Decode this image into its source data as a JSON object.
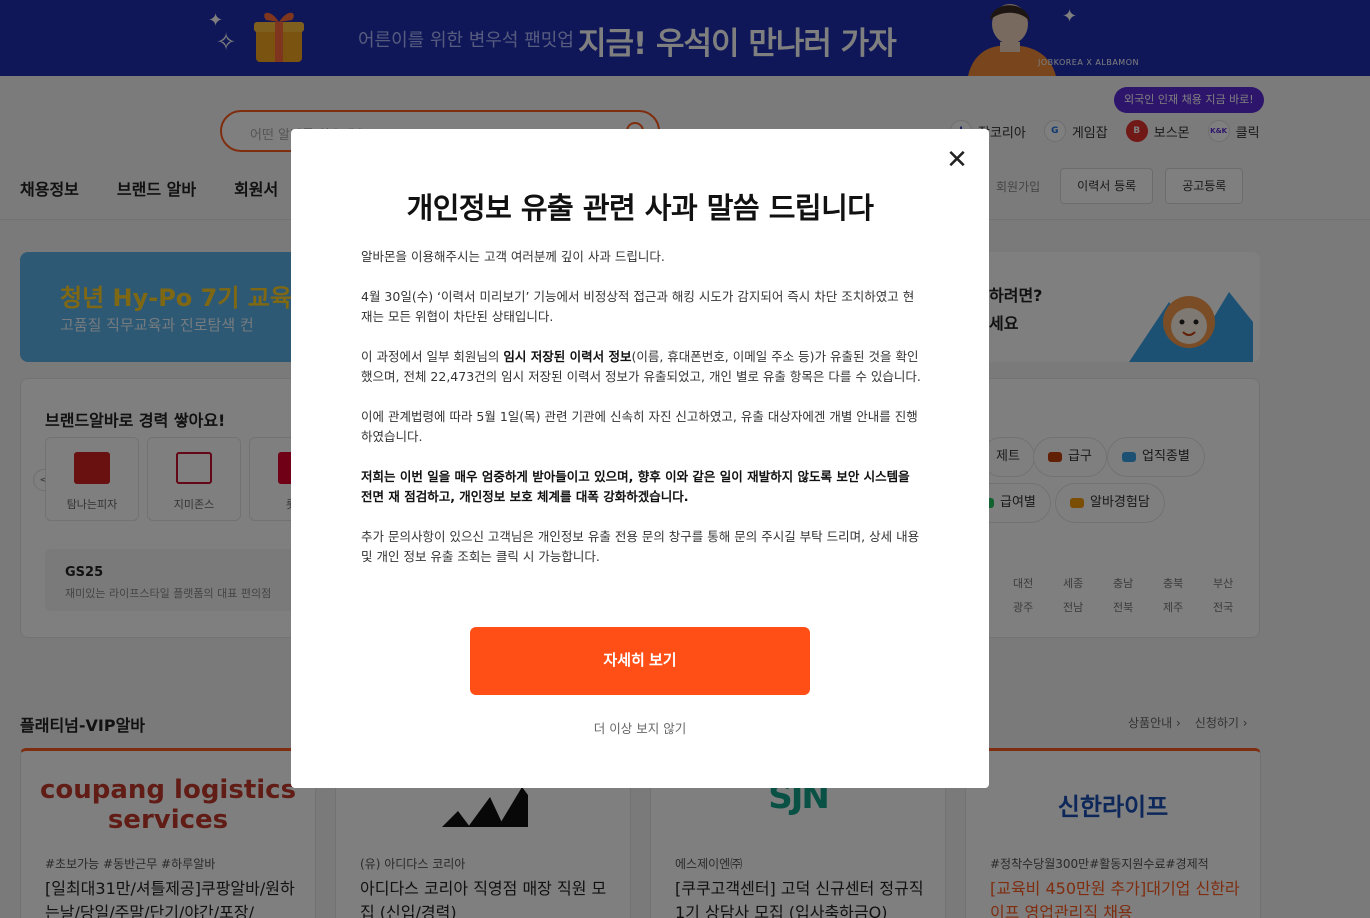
{
  "banner": {
    "sub_text": "어른이를 위한 변우석 팬밋업",
    "main_text": "지금! 우석이 만나러 가자",
    "brandmark": "JOBKOREA X ALBAMON"
  },
  "header": {
    "search_placeholder": "어떤 알바를 찾으세요?",
    "tooltip": "외국인 인재 채용 지금 바로!",
    "family_sites": [
      {
        "label": "잡코리아",
        "icon": "J"
      },
      {
        "label": "게임잡",
        "icon": "G"
      },
      {
        "label": "보스몬",
        "icon": "B"
      },
      {
        "label": "클릭",
        "icon": "K&K"
      }
    ],
    "nav": [
      "채용정보",
      "브랜드 알바",
      "회원서"
    ],
    "join_label": "회원가입",
    "resume_button": "이력서 등록",
    "post_button": "공고등록"
  },
  "promo": {
    "left_title": "청년 Hy-Po 7기 교육",
    "left_sub": "고품질 직무교육과 진로탐색 컨",
    "right_line1": "하려면?",
    "right_line2": "세요"
  },
  "brands": {
    "title": "브랜드알바로 경력 쌓아요!",
    "cards": [
      {
        "name": "탐나는피자",
        "color": "#d32121"
      },
      {
        "name": "지미존스",
        "color": "#ffffff"
      },
      {
        "name": "롯데",
        "color": "#e0002b"
      }
    ],
    "featured_name": "GS25",
    "featured_desc": "재미있는 라이프스타일 플랫폼의 대표 편의점",
    "chips_row1": [
      "제트",
      "급구",
      "업직종별"
    ],
    "chips_row2": [
      "급여별",
      "알바경험담"
    ],
    "regions": [
      "대전",
      "세종",
      "충남",
      "충북",
      "부산",
      "광주",
      "전남",
      "전북",
      "제주",
      "전국"
    ]
  },
  "platinum": {
    "title": "플래티넘-VIP알바",
    "link_products": "상품안내",
    "link_apply": "신청하기",
    "cards": [
      {
        "logo": "coupang logistics services",
        "sub": "#초보가능 #동반근무 #하루알바",
        "title": "[일최대31만/셔틀제공]쿠팡알바/원하는날/당일/주말/단기/야간/포장/",
        "orange": false
      },
      {
        "logo": "adidas",
        "sub": "(유) 아디다스 코리아",
        "title": "아디다스 코리아 직영점 매장 직원 모집 (신입/경력)",
        "orange": false
      },
      {
        "logo": "SJN",
        "sub": "에스제이엔㈜",
        "title": "[쿠쿠고객센터] 고덕 신규센터 정규직 1기 상담사 모집 (입사축하금O)",
        "orange": false
      },
      {
        "logo": "신한라이프",
        "sub": "#정착수당월300만#활동지원수료#경제적",
        "title": "[교육비 450만원 추가]대기업 신한라이프 영업관리직 채용",
        "orange": true
      }
    ]
  },
  "modal": {
    "title": "개인정보 유출 관련 사과 말씀 드립니다",
    "p1": "알바몬을 이용해주시는 고객 여러분께 깊이 사과 드립니다.",
    "p2": "4월 30일(수) ‘이력서 미리보기’ 기능에서 비정상적 접근과 해킹 시도가 감지되어 즉시 차단 조치하였고 현재는 모든 위협이 차단된 상태입니다.",
    "p3_a": "이 과정에서 일부 회원님의 ",
    "p3_bold": "임시 저장된 이력서 정보",
    "p3_b": "(이름, 휴대폰번호, 이메일 주소 등)가 유출된 것을 확인했으며, 전체 22,473건의 임시 저장된 이력서 정보가 유출되었고, 개인 별로 유출 항목은 다를 수 있습니다.",
    "p4": "이에 관계법령에 따라 5월 1일(목) 관련 기관에 신속히 자진 신고하였고, 유출 대상자에겐 개별 안내를 진행하였습니다.",
    "p5": "저희는 이번 일을 매우 엄중하게 받아들이고 있으며, 향후 이와 같은 일이 재발하지 않도록 보안 시스템을 전면 재 점검하고, 개인정보 보호 체계를 대폭 강화하겠습니다.",
    "p6": "추가 문의사항이 있으신 고객님은 개인정보 유출 전용 문의 창구를 통해 문의 주시길 부탁 드리며, 상세 내용 및 개인 정보 유출 조회는 클릭 시 가능합니다.",
    "cta": "자세히 보기",
    "dismiss": "더 이상 보지 않기"
  }
}
